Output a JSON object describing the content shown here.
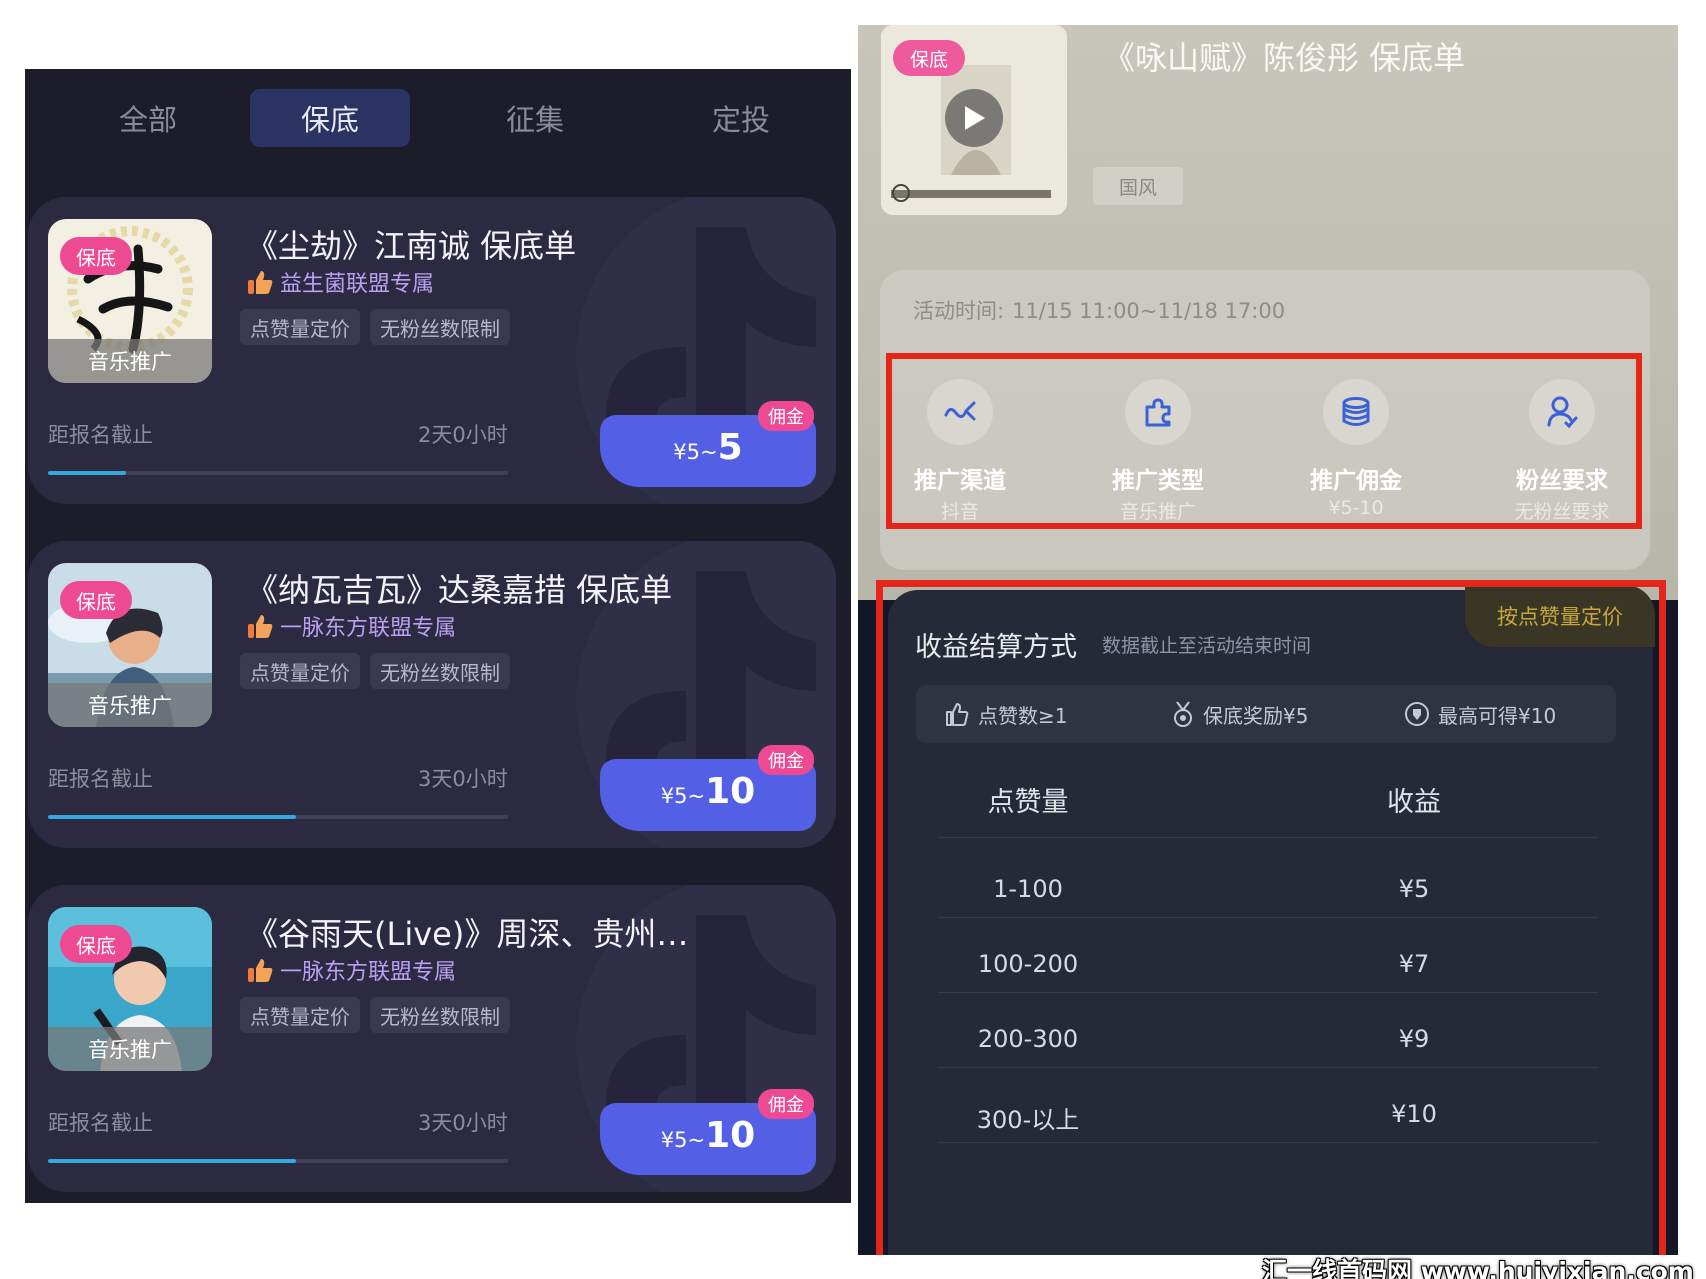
{
  "tabs": [
    "全部",
    "保底",
    "征集",
    "定投"
  ],
  "active_tab": 1,
  "cards": [
    {
      "badge": "保底",
      "cover_label": "音乐推广",
      "cover_char": "诚",
      "title": "《尘劫》江南诚 保底单",
      "alliance": "益生菌联盟专属",
      "tags": [
        "点赞量定价",
        "无粉丝数限制"
      ],
      "deadline_label": "距报名截止",
      "deadline_value": "2天0小时",
      "progress": 0.17,
      "price_prefix": "¥5~",
      "price_max": "5",
      "commission": "佣金"
    },
    {
      "badge": "保底",
      "cover_label": "音乐推广",
      "title": "《纳瓦吉瓦》达桑嘉措 保底单",
      "alliance": "一脉东方联盟专属",
      "tags": [
        "点赞量定价",
        "无粉丝数限制"
      ],
      "deadline_label": "距报名截止",
      "deadline_value": "3天0小时",
      "progress": 0.54,
      "price_prefix": "¥5~",
      "price_max": "10",
      "commission": "佣金"
    },
    {
      "badge": "保底",
      "cover_label": "音乐推广",
      "title": "《谷雨天(Live)》周深、贵州…",
      "alliance": "一脉东方联盟专属",
      "tags": [
        "点赞量定价",
        "无粉丝数限制"
      ],
      "deadline_label": "距报名截止",
      "deadline_value": "3天0小时",
      "progress": 0.54,
      "price_prefix": "¥5~",
      "price_max": "10",
      "commission": "佣金"
    }
  ],
  "detail": {
    "badge": "保底",
    "title": "《咏山赋》陈俊彤 保底单",
    "genre": "国风",
    "activity_time_label": "活动时间:",
    "activity_time_value": "11/15 11:00~11/18 17:00",
    "info": [
      {
        "icon": "share-icon",
        "label": "推广渠道",
        "value": "抖音"
      },
      {
        "icon": "puzzle-icon",
        "label": "推广类型",
        "value": "音乐推广"
      },
      {
        "icon": "coins-icon",
        "label": "推广佣金",
        "value": "¥5-10"
      },
      {
        "icon": "fans-icon",
        "label": "粉丝要求",
        "value": "无粉丝要求"
      }
    ],
    "settlement": {
      "price_type": "按点赞量定价",
      "title": "收益结算方式",
      "subtitle": "数据截止至活动结束时间",
      "rules": [
        {
          "icon": "like-icon",
          "text": "点赞数≥1"
        },
        {
          "icon": "medal-icon",
          "text": "保底奖励¥5"
        },
        {
          "icon": "max-reward-icon",
          "text": "最高可得¥10"
        }
      ],
      "headers": [
        "点赞量",
        "收益"
      ],
      "rows": [
        [
          "1-100",
          "¥5"
        ],
        [
          "100-200",
          "¥7"
        ],
        [
          "200-300",
          "¥9"
        ],
        [
          "300-以上",
          "¥10"
        ]
      ]
    }
  },
  "site_watermark": "汇一线首码网 www.huiyixian.com"
}
